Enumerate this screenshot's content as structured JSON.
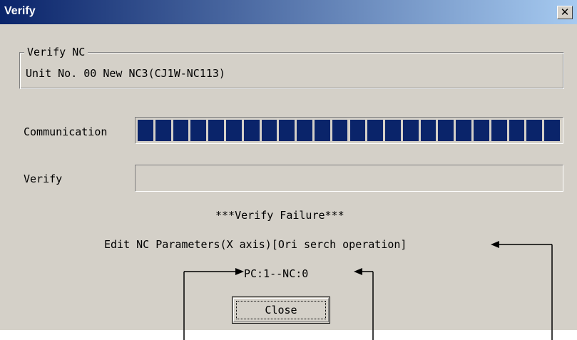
{
  "window": {
    "title": "Verify",
    "close_glyph": "✕"
  },
  "group": {
    "legend": "Verify NC",
    "text": "Unit No. 00 New NC3(CJ1W-NC113)"
  },
  "communication": {
    "label": "Communication",
    "progress": 1.0,
    "segments": 24,
    "fill_color": "#0a246a"
  },
  "verify": {
    "label": "Verify",
    "progress": 0.0
  },
  "messages": {
    "failure": "***Verify Failure***",
    "detail": "Edit NC Parameters(X axis)[Ori serch operation]",
    "counts": "PC:1--NC:0"
  },
  "buttons": {
    "close": "Close"
  }
}
